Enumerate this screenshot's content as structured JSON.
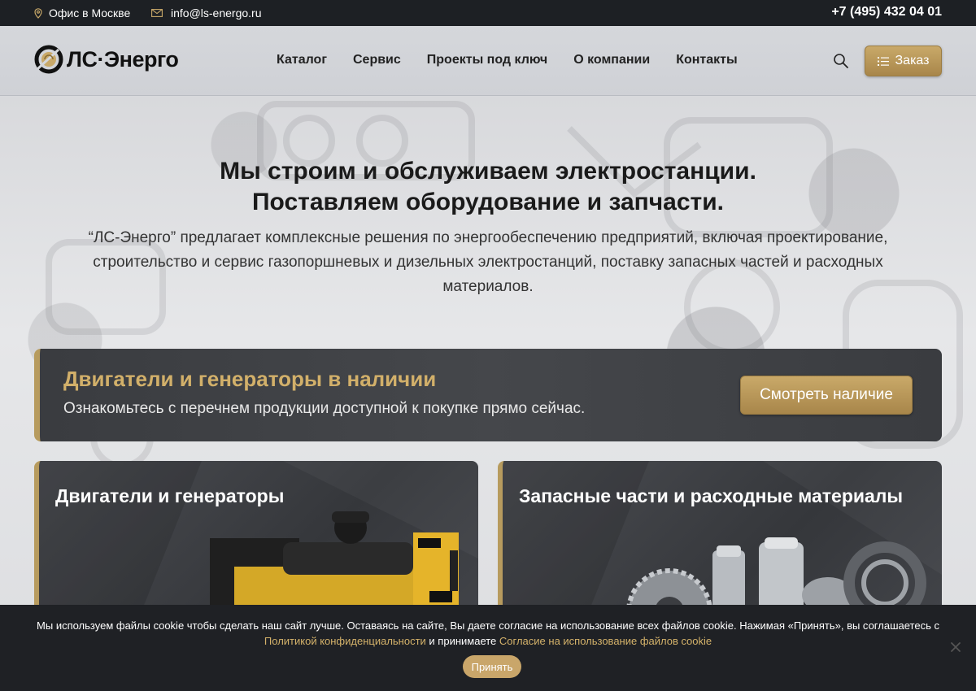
{
  "topbar": {
    "office": "Офис в Москве",
    "email": "info@ls-energo.ru",
    "phone": "+7 (495) 432 04 01"
  },
  "header": {
    "logo_text": "ЛС·Энерго",
    "nav": [
      "Каталог",
      "Сервис",
      "Проекты под ключ",
      "О компании",
      "Контакты"
    ],
    "order_label": "Заказ",
    "icons": [
      "search-icon",
      "list-icon"
    ]
  },
  "hero": {
    "title_line1": "Мы строим и обслуживаем электростанции.",
    "title_line2": "Поставляем оборудование и запчасти.",
    "text": "“ЛС-Энерго” предлагает комплексные решения по энергообеспечению предприятий, включая проектирование, строительство и сервис газопоршневых и дизельных электростанций, поставку запасных частей и расходных материалов."
  },
  "banner": {
    "title": "Двигатели и генераторы в наличии",
    "subtitle": "Ознакомьтесь с перечнем продукции доступной к покупке прямо сейчас.",
    "button": "Смотреть наличие"
  },
  "cards": [
    {
      "title": "Двигатели и генераторы"
    },
    {
      "title": "Запасные части и расходные материалы"
    }
  ],
  "cookie": {
    "text1": "Мы используем файлы cookie чтобы сделать наш сайт лучше. Оставаясь на сайте, Вы даете согласие на использование всех файлов cookie. Нажимая «Принять», вы соглашаетесь с",
    "link_privacy": "Политикой конфиденциальности",
    "and_accept": " и принимаете ",
    "link_cookie": "Согласие на использование файлов cookie",
    "accept": "Принять"
  },
  "colors": {
    "gold": "#c9a969",
    "dark": "#1d2024"
  }
}
